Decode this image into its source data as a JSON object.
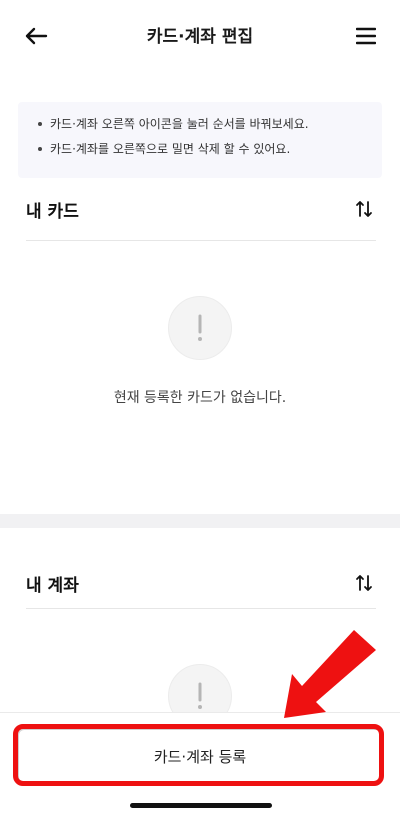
{
  "header": {
    "title": "카드·계좌 편집",
    "back_icon": "arrow-left-icon",
    "menu_icon": "hamburger-menu-icon"
  },
  "notice": {
    "items": [
      "카드·계좌 오른쪽 아이콘을 눌러 순서를 바꿔보세요.",
      "카드·계좌를 오른쪽으로 밀면 삭제 할 수 있어요."
    ]
  },
  "cards_section": {
    "title": "내 카드",
    "sort_icon": "sort-arrows-icon",
    "empty_icon": "exclamation-icon",
    "empty_text": "현재 등록한 카드가 없습니다."
  },
  "accounts_section": {
    "title": "내 계좌",
    "sort_icon": "sort-arrows-icon",
    "empty_icon": "exclamation-icon"
  },
  "bottom": {
    "register_label": "카드·계좌 등록"
  },
  "annotation": {
    "color": "#ee1111",
    "arrow_icon": "red-pointer-arrow-icon"
  }
}
